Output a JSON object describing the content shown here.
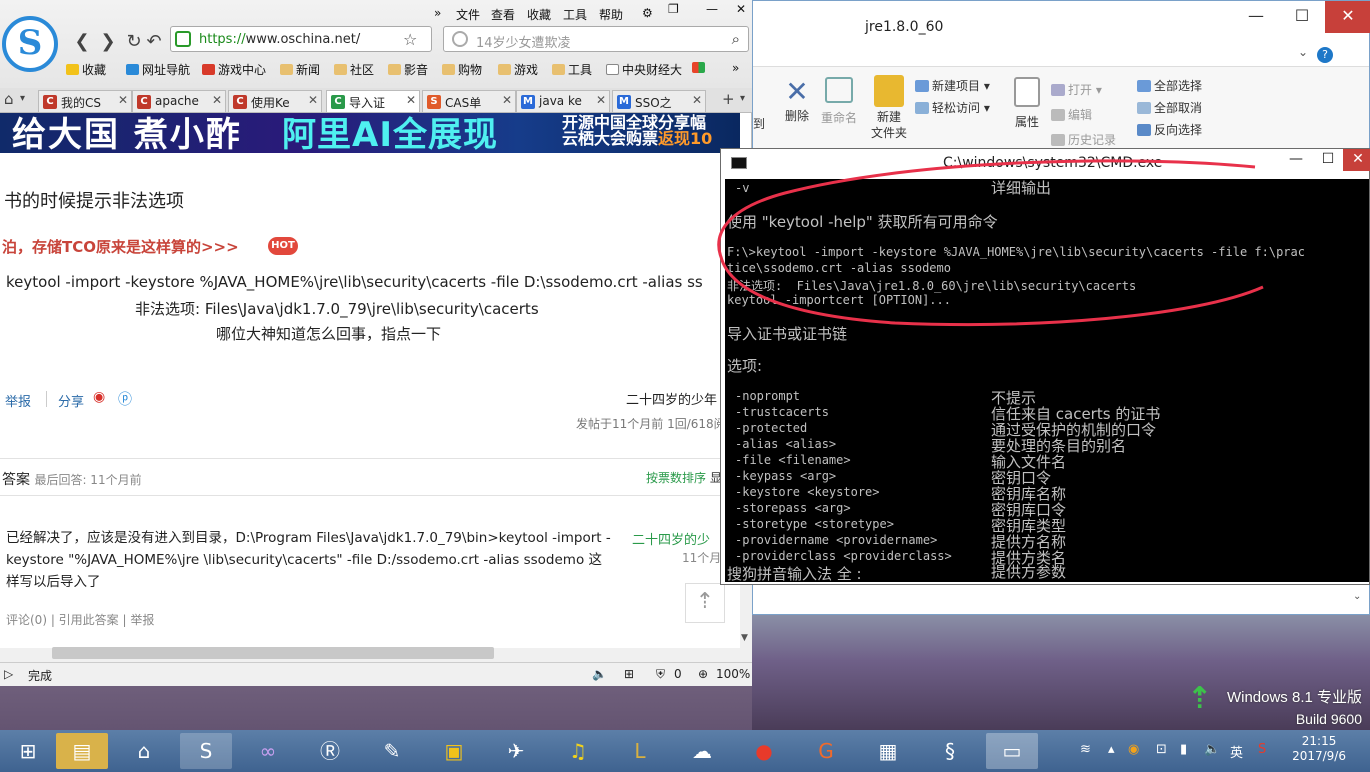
{
  "browser": {
    "menu": [
      "文件",
      "查看",
      "收藏",
      "工具",
      "帮助"
    ],
    "url": "https://www.oschina.net/",
    "url_scheme": "https://",
    "url_rest": "www.oschina.net/",
    "search_placeholder": "14岁少女遭欺凌",
    "favorites": [
      "收藏",
      "网址导航",
      "游戏中心",
      "新闻",
      "社区",
      "影音",
      "购物",
      "游戏",
      "工具",
      "中央财经大"
    ],
    "tabs": [
      {
        "label": "我的CS",
        "icon": "C",
        "color": "#c0392b"
      },
      {
        "label": "apache",
        "icon": "C",
        "color": "#c0392b"
      },
      {
        "label": "使用Ke",
        "icon": "C",
        "color": "#c0392b"
      },
      {
        "label": "导入证",
        "icon": "C",
        "color": "#2a9a4a"
      },
      {
        "label": "CAS单",
        "icon": "S",
        "color": "#e05a2a"
      },
      {
        "label": "java ke",
        "icon": "M",
        "color": "#2a6ad8"
      },
      {
        "label": "SSO之",
        "icon": "M",
        "color": "#2a6ad8"
      }
    ],
    "banner": {
      "left": "给大国 煮小酢",
      "mid": "阿里AI全展现",
      "right1": "开源中国全球分享幅",
      "right2": "云栖大会购票",
      "right2b": "返现10"
    },
    "question_title": "书的时候提示非法选项",
    "hot_link": "泊，存储TCO原来是这样算的>>>",
    "hot_badge": "HOT",
    "question_body": [
      "keytool -import -keystore %JAVA_HOME%\\jre\\lib\\security\\cacerts -file D:\\ssodemo.crt -alias ss",
      "非法选项:  Files\\Java\\jdk1.7.0_79\\jre\\lib\\security\\cacerts",
      "哪位大神知道怎么回事，指点一下"
    ],
    "report": "举报",
    "share": "分享",
    "author": "二十四岁的少年",
    "post_meta": "发帖于11个月前 1回/618阅",
    "answers_label": "答案",
    "last_answer": "最后回答: 11个月前",
    "sort_label": "按票数排序",
    "sort_label2": "显",
    "answer_text": "已经解决了，应该是没有进入到目录，D:\\Program Files\\Java\\jdk1.7.0_79\\bin>keytool -import -keystore \"%JAVA_HOME%\\jre \\lib\\security\\cacerts\" -file D:/ssodemo.crt -alias ssodemo 这样写以后导入了",
    "answer_user": "二十四岁的少",
    "answer_time": "11个月",
    "answer_links": "评论(0) | 引用此答案 | 举报",
    "status": "完成",
    "status_count": "0",
    "zoom": "100%"
  },
  "explorer": {
    "title": "jre1.8.0_60",
    "ribbon": {
      "delete": "删除",
      "rename": "重命名",
      "new_folder": "新建\n文件夹",
      "new_item": "新建项目",
      "easy_access": "轻松访问",
      "properties": "属性",
      "open": "打开",
      "edit": "编辑",
      "history": "历史记录",
      "select_all": "全部选择",
      "select_none": "全部取消",
      "invert": "反向选择",
      "side": "到"
    }
  },
  "cmd": {
    "title": "C:\\windows\\system32\\CMD.exe",
    "lines": [
      {
        "t": "-v",
        "d": "详细输出"
      },
      {
        "t": "使用 \"keytool -help\" 获取所有可用命令"
      },
      {
        "t": "F:\\>keytool -import -keystore %JAVA_HOME%\\jre\\lib\\security\\cacerts -file f:\\prac"
      },
      {
        "t": "tice\\ssodemo.crt -alias ssodemo"
      },
      {
        "t": "非法选项:  Files\\Java\\jre1.8.0_60\\jre\\lib\\security\\cacerts"
      },
      {
        "t": "keytool -importcert [OPTION]..."
      },
      {
        "t": "导入证书或证书链"
      },
      {
        "t": "选项:"
      }
    ],
    "options": [
      {
        "o": "-noprompt",
        "d": "不提示"
      },
      {
        "o": "-trustcacerts",
        "d": "信任来自 cacerts 的证书"
      },
      {
        "o": "-protected",
        "d": "通过受保护的机制的口令"
      },
      {
        "o": "-alias <alias>",
        "d": "要处理的条目的别名"
      },
      {
        "o": "-file <filename>",
        "d": "输入文件名"
      },
      {
        "o": "-keypass <arg>",
        "d": "密钥口令"
      },
      {
        "o": "-keystore <keystore>",
        "d": "密钥库名称"
      },
      {
        "o": "-storepass <arg>",
        "d": "密钥库口令"
      },
      {
        "o": "-storetype <storetype>",
        "d": "密钥库类型"
      },
      {
        "o": "-providername <providername>",
        "d": "提供方名称"
      },
      {
        "o": "-providerclass <providerclass>",
        "d": "提供方类名"
      }
    ],
    "ime": "搜狗拼音输入法 全 :",
    "last_desc": "提供方参数"
  },
  "watermark": {
    "line1": "Windows 8.1 专业版",
    "line2": "Build 9600"
  },
  "taskbar": {
    "time": "21:15",
    "date": "2017/9/6",
    "lang": "英"
  },
  "colors": {
    "annotation": "#e8314a",
    "taskbar": "#4a6e9c"
  }
}
